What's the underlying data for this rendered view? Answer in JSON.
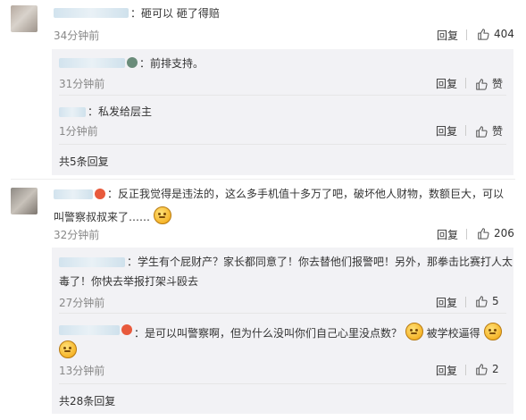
{
  "comments": [
    {
      "text": "：砸可以 砸了得赔",
      "time": "34分钟前",
      "reply_label": "回复",
      "likes": "404",
      "replies": [
        {
          "text": "：前排支持。",
          "time": "31分钟前",
          "reply_label": "回复",
          "likes": "赞"
        },
        {
          "text": "：私发给层主",
          "time": "1分钟前",
          "reply_label": "回复",
          "likes": "赞"
        }
      ],
      "more": "共5条回复"
    },
    {
      "text_line1": "：反正我觉得是违法的，这么多手机值十多万了吧，破坏他人财物，数额巨大，可以",
      "text_line2": "叫警察叔叔来了……",
      "time": "32分钟前",
      "reply_label": "回复",
      "likes": "206",
      "replies": [
        {
          "text_line1": "：学生有个屁财产？家长都同意了！你去替他们报警吧！另外，那拳击比赛打人太",
          "text_line2": "毒了！你快去举报打架斗殴去",
          "time": "27分钟前",
          "reply_label": "回复",
          "likes": "5"
        },
        {
          "text_line1": "：是可以叫警察啊，但为什么没叫你们自己心里没点数？",
          "text_line1b": "被学校逼得",
          "time": "13分钟前",
          "reply_label": "回复",
          "likes": "2"
        }
      ],
      "more": "共28条回复"
    }
  ],
  "icons": {
    "like": "thumbs-up-icon",
    "emoji": "thinking-face-icon",
    "badge": "user-badge-icon"
  }
}
